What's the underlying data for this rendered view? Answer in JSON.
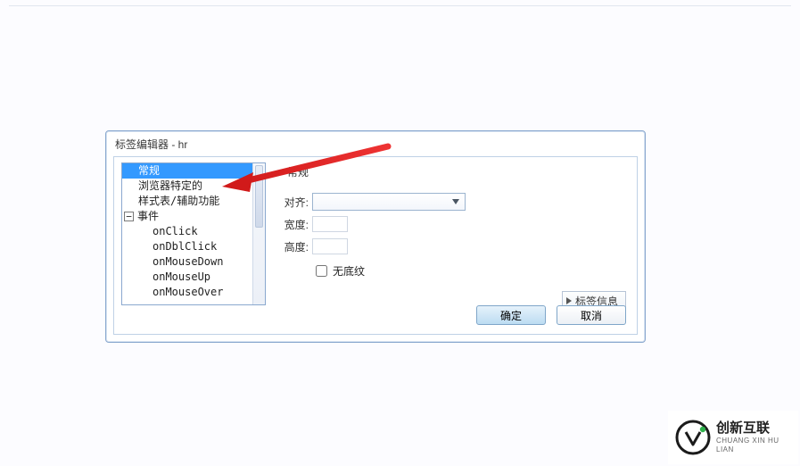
{
  "dialog": {
    "title": "标签编辑器 - hr",
    "tree": {
      "selected": "常规",
      "items": [
        {
          "label": "常规",
          "level": 1,
          "selected": true
        },
        {
          "label": "浏览器特定的",
          "level": 1
        },
        {
          "label": "样式表/辅助功能",
          "level": 1
        },
        {
          "label": "事件",
          "level": 0,
          "toggle": "minus"
        },
        {
          "label": "onClick",
          "level": 2
        },
        {
          "label": "onDblClick",
          "level": 2
        },
        {
          "label": "onMouseDown",
          "level": 2
        },
        {
          "label": "onMouseUp",
          "level": 2
        },
        {
          "label": "onMouseOver",
          "level": 2
        }
      ]
    },
    "section": {
      "prefix": "",
      "name": "常规"
    },
    "form": {
      "align_label": "对齐:",
      "width_label": "宽度:",
      "height_label": "高度:",
      "noshade_label": "无底纹"
    },
    "tag_info_button": "标签信息",
    "ok_label": "确定",
    "cancel_label": "取消"
  },
  "watermark": {
    "cn": "创新互联",
    "en": "CHUANG XIN HU LIAN"
  }
}
